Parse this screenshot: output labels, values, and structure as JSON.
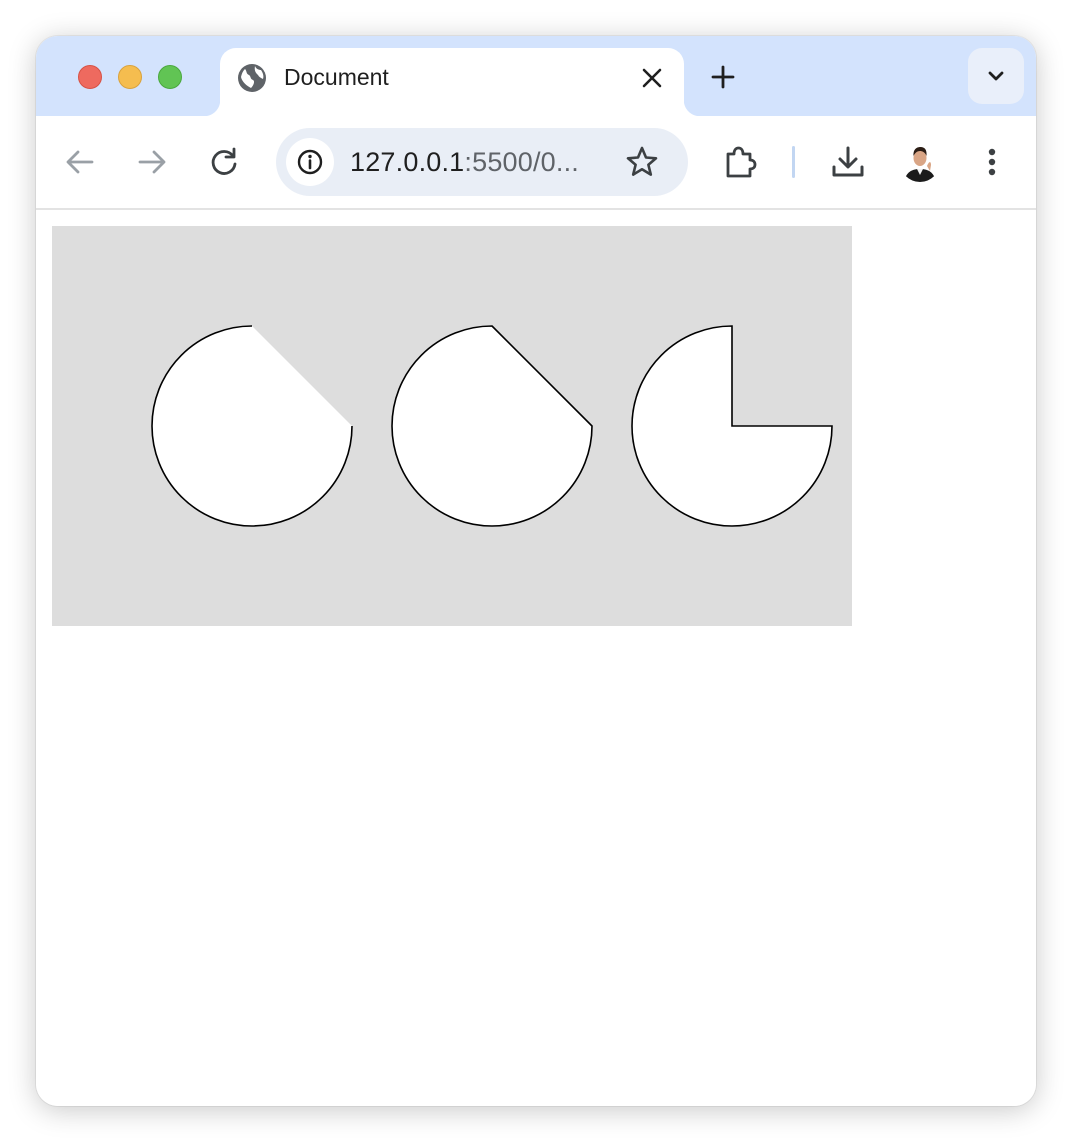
{
  "browser": {
    "tab": {
      "title": "Document",
      "favicon": "globe-icon"
    },
    "address_bar": {
      "url_host": "127.0.0.1",
      "url_rest": ":5500/0...",
      "site_info_icon": "info-icon",
      "bookmark_icon": "star-icon"
    },
    "toolbar_icons": [
      "back-arrow-icon",
      "forward-arrow-icon",
      "reload-icon",
      "extensions-icon",
      "download-icon",
      "profile-avatar",
      "more-vert-icon"
    ],
    "colors": {
      "tabstrip": "#d3e3fd",
      "omnibox": "#e9eef6",
      "close": "#ee6a5f",
      "minimize": "#f5bd4f",
      "maximize": "#61c454"
    }
  },
  "page": {
    "canvas_background": "#dddddd",
    "shapes": [
      {
        "name": "pie-shape-1",
        "missing_slice": "chord cut, top-right quarter"
      },
      {
        "name": "pie-shape-2",
        "missing_slice": "chord cut with straight edges, top-right quarter"
      },
      {
        "name": "pie-shape-3",
        "missing_slice": "quarter wedge, top-right"
      }
    ],
    "shape_fill": "#ffffff",
    "shape_stroke": "#000000"
  }
}
